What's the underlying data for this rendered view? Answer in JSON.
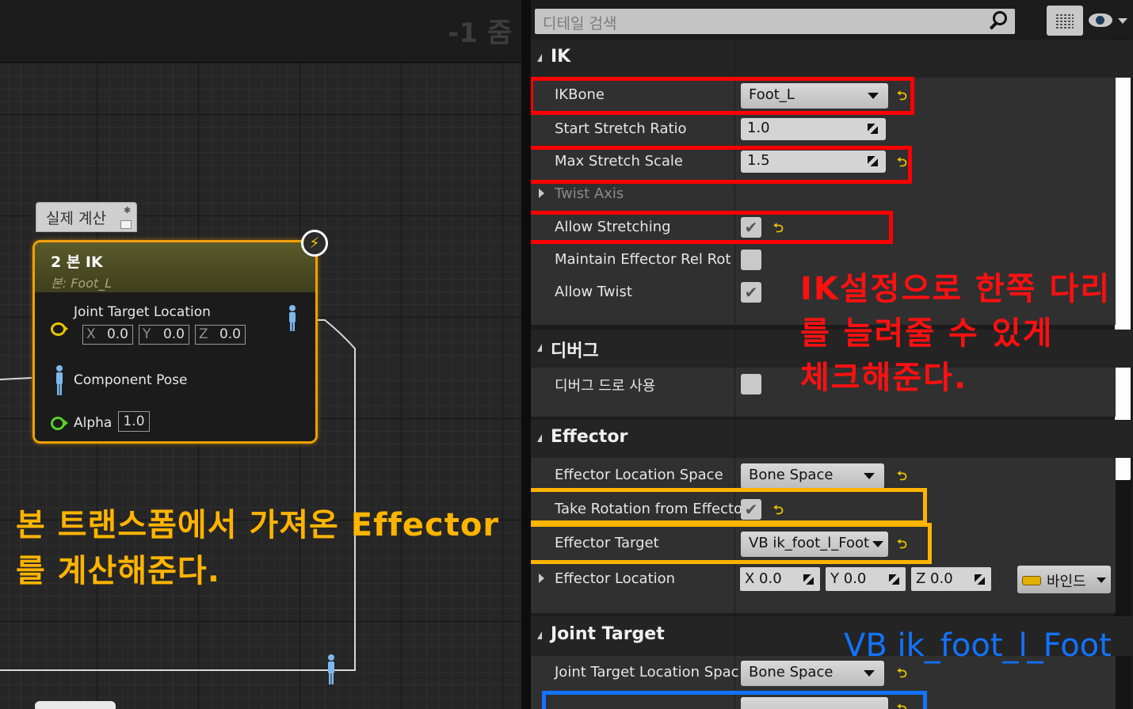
{
  "graph": {
    "zoom_label": "-1 줌",
    "comment_label": "실제 계산",
    "node": {
      "title": "2 본 IK",
      "subtitle": "본: Foot_L",
      "pins": {
        "joint_target_label": "Joint Target Location",
        "joint_target_x_axis": "X",
        "joint_target_x": "0.0",
        "joint_target_y_axis": "Y",
        "joint_target_y": "0.0",
        "joint_target_z_axis": "Z",
        "joint_target_z": "0.0",
        "component_pose_label": "Component Pose",
        "alpha_label": "Alpha",
        "alpha_value": "1.0"
      }
    },
    "annotation_line1": "본 트랜스폼에서 가져온 Effector",
    "annotation_line2": "를 계산해준다."
  },
  "details": {
    "search_placeholder": "디테일 검색",
    "icons": [
      "search-icon",
      "grid-view-icon",
      "eye-icon",
      "chevron-down-icon",
      "reset-arrow-icon",
      "checkmark-icon",
      "drag-arrows-icon",
      "bind-icon"
    ],
    "categories": {
      "ik": "IK",
      "debug": "디버그",
      "effector": "Effector",
      "joint_target": "Joint Target"
    },
    "ik": {
      "ikbone_label": "IKBone",
      "ikbone_value": "Foot_L",
      "start_stretch_ratio_label": "Start Stretch Ratio",
      "start_stretch_ratio_value": "1.0",
      "max_stretch_scale_label": "Max Stretch Scale",
      "max_stretch_scale_value": "1.5",
      "twist_axis_label": "Twist Axis",
      "allow_stretching_label": "Allow Stretching",
      "allow_stretching_checked": true,
      "maintain_effector_label": "Maintain Effector Rel Rot",
      "maintain_effector_checked": false,
      "allow_twist_label": "Allow Twist",
      "allow_twist_checked": true
    },
    "debug": {
      "draw_debug_label": "디버그 드로 사용",
      "draw_debug_checked": false
    },
    "effector": {
      "location_space_label": "Effector Location Space",
      "location_space_value": "Bone Space",
      "take_rotation_label": "Take Rotation from Effecto",
      "take_rotation_checked": true,
      "target_label": "Effector Target",
      "target_value": "VB ik_foot_l_Foot",
      "location_label": "Effector Location",
      "location_x": "X  0.0",
      "location_y": "Y  0.0",
      "location_z": "Z  0.0",
      "bind_label": "바인드"
    },
    "joint_target": {
      "location_space_label": "Joint Target Location Spac",
      "location_space_value": "Bone Space"
    },
    "reset_glyph": "⮌",
    "check_glyph": "✔"
  },
  "annotations": {
    "red_line1": "IK설정으로 한쪽 다리",
    "red_line2": "를 늘려줄 수 있게",
    "red_line3": "체크해준다.",
    "blue_note": "VB ik_foot_l_Foot"
  },
  "colors": {
    "highlight_red": "#ff0000",
    "highlight_yellow": "#ffb400",
    "highlight_blue": "#1273ff",
    "node_border": "#f2a000",
    "exec_pin": "#e6c700",
    "float_pin": "#57d12b"
  }
}
